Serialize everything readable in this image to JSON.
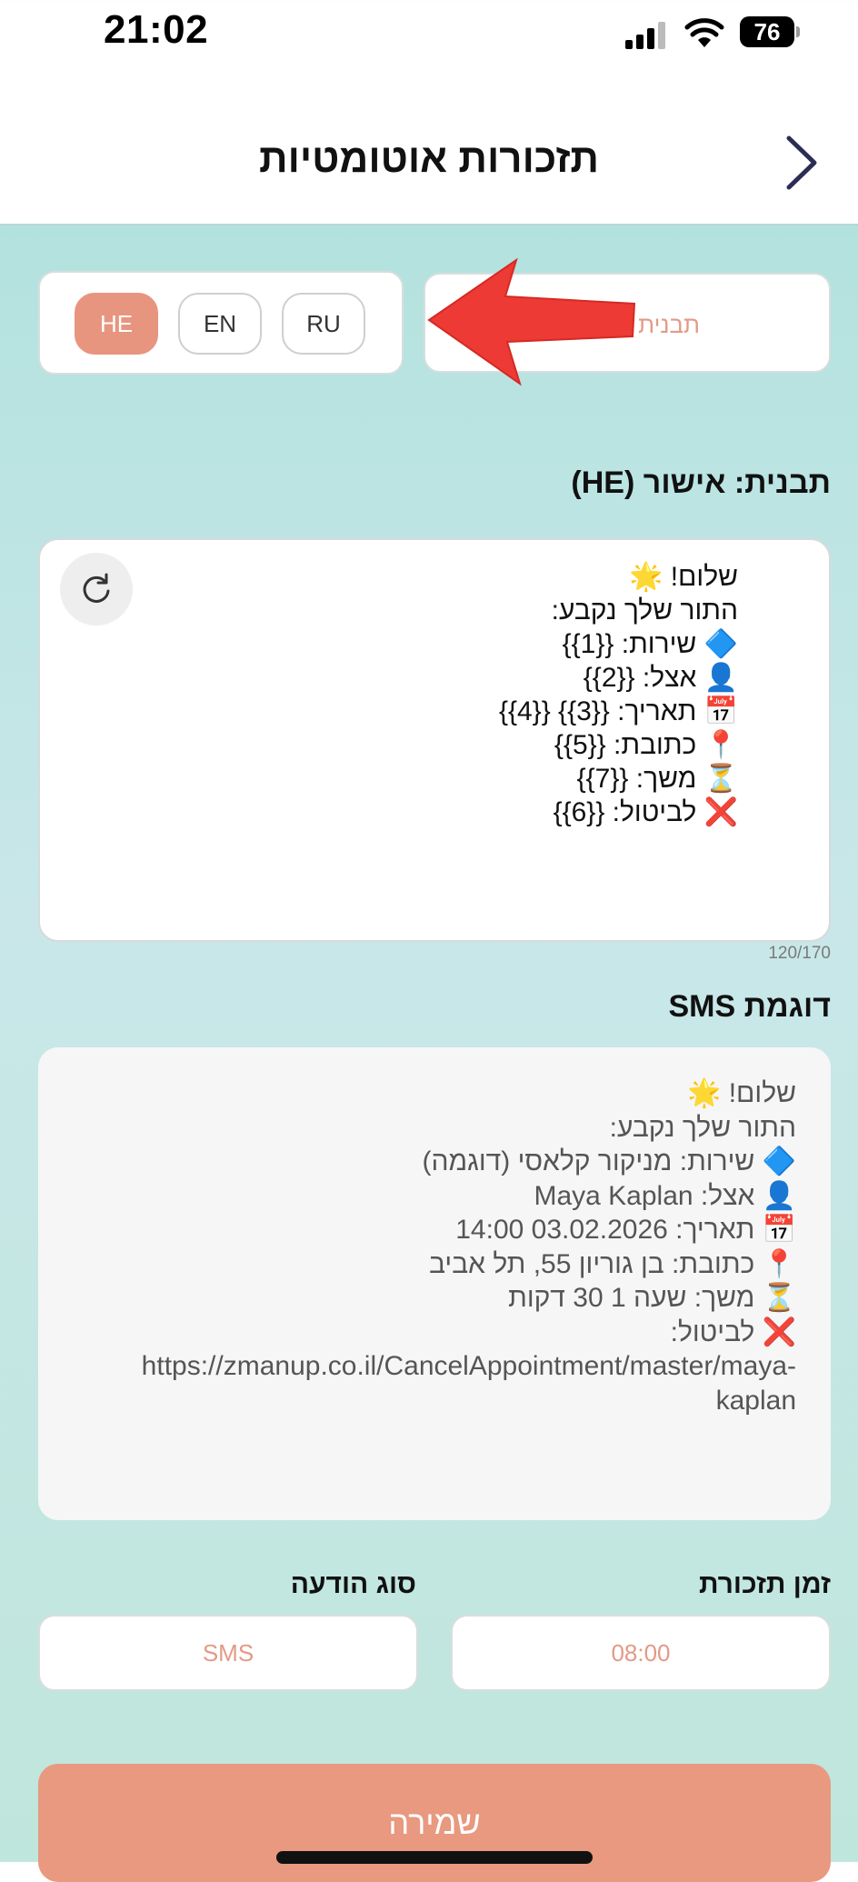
{
  "status_bar": {
    "time": "21:02",
    "battery": "76"
  },
  "header": {
    "title": "תזכורות אוטומטיות"
  },
  "template_select": {
    "placeholder": "תבנית הו"
  },
  "languages": [
    {
      "label": "RU",
      "active": false
    },
    {
      "label": "EN",
      "active": false
    },
    {
      "label": "HE",
      "active": true
    }
  ],
  "template": {
    "heading": "תבנית: אישור (HE)",
    "text": "שלום! 🌟\nהתור שלך נקבע:\n🔷 שירות: {{1}}\n👤 אצל: {{2}}\n📅 תאריך: {{3}} {{4}}\n📍 כתובת: {{5}}\n⏳ משך: {{7}}\n❌ לביטול: {{6}}",
    "counter": "120/170"
  },
  "sms_preview": {
    "heading": "דוגמת SMS",
    "text": "שלום! 🌟\nהתור שלך נקבע:\n🔷 שירות: מניקור קלאסי (דוגמה)\n👤 אצל: Maya Kaplan\n📅 תאריך: 03.02.2026 14:00\n📍 כתובת: בן גוריון 55, תל אביב\n⏳ משך: שעה 1 30 דקות\n❌ לביטול: https://zmanup.co.il/CancelAppointment/master/maya-kaplan"
  },
  "reminder_time": {
    "label": "זמן תזכורת",
    "value": "08:00"
  },
  "message_type": {
    "label": "סוג הודעה",
    "value": "SMS"
  },
  "save_label": "שמירה",
  "colors": {
    "accent": "#e8957f",
    "arrow": "#ee3a34"
  }
}
